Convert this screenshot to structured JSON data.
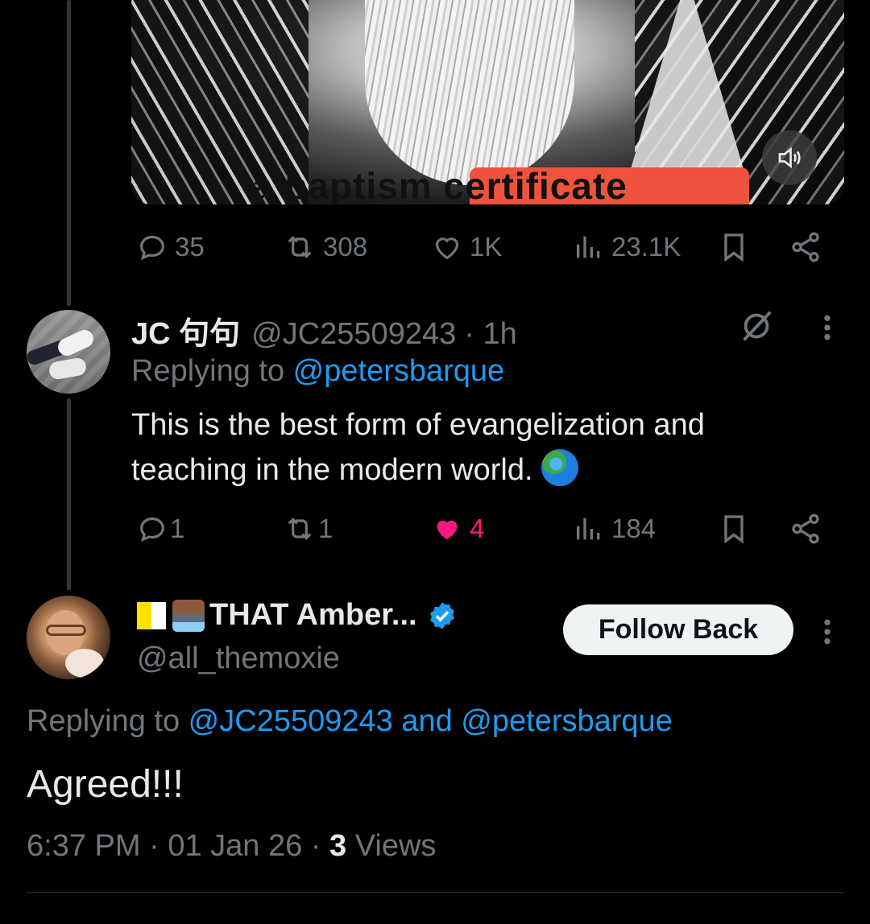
{
  "media": {
    "caption": "a baptism certificate",
    "sound_icon": "speaker-volume-icon"
  },
  "top_post_actions": {
    "replies": "35",
    "reposts": "308",
    "likes": "1K",
    "views": "23.1K"
  },
  "reply1": {
    "name": "JC 句句",
    "handle": "@JC25509243",
    "time": "· 1h",
    "replying_prefix": "Replying to ",
    "replying_to": "@petersbarque",
    "text": "This is the best form of evangelization and teaching in the modern world.",
    "actions": {
      "replies": "1",
      "reposts": "1",
      "likes": "4",
      "views": "184"
    },
    "like_color": "#f91880"
  },
  "reply2": {
    "name": "THAT Amber...",
    "handle": "@all_themoxie",
    "follow_label": "Follow Back",
    "replying_prefix": "Replying to ",
    "replying_to_1": "@JC25509243",
    "replying_and": " and ",
    "replying_to_2": "@petersbarque",
    "text": "Agreed!!!",
    "time": "6:37 PM",
    "sep1": " · ",
    "date": "01 Jan 26",
    "sep2": " · ",
    "views_count": "3",
    "views_label": " Views",
    "verified_color": "#1d9bf0"
  },
  "colors": {
    "background": "#000000",
    "text": "#e7e9ea",
    "muted": "#71767b",
    "accent": "#1d9bf0"
  }
}
